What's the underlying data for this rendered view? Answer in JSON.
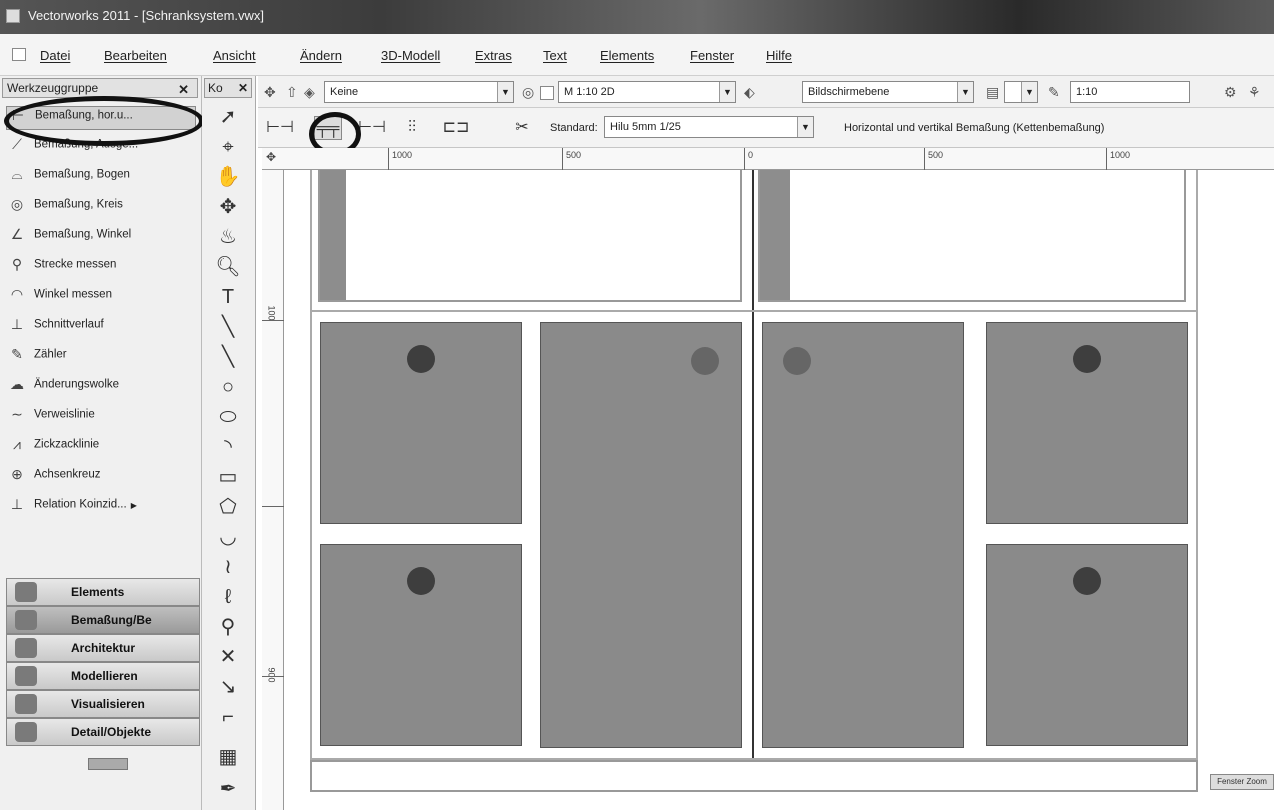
{
  "window": {
    "title": "Vectorworks 2011 - [Schranksystem.vwx]"
  },
  "menu": [
    "Datei",
    "Bearbeiten",
    "Ansicht",
    "Ändern",
    "3D-Modell",
    "Extras",
    "Text",
    "Elements",
    "Fenster",
    "Hilfe"
  ],
  "tools_panel": {
    "title": "Werkzeuggruppe",
    "items": [
      {
        "icon": "horizontal-dimension-icon",
        "label": "Bemaßung, hor.u..."
      },
      {
        "icon": "aligned-dimension-icon",
        "label": "Bemaßung, Ausge..."
      },
      {
        "icon": "arc-dimension-icon",
        "label": "Bemaßung, Bogen"
      },
      {
        "icon": "circle-dimension-icon",
        "label": "Bemaßung, Kreis"
      },
      {
        "icon": "angle-dimension-icon",
        "label": "Bemaßung, Winkel"
      },
      {
        "icon": "measure-distance-icon",
        "label": "Strecke messen"
      },
      {
        "icon": "measure-angle-icon",
        "label": "Winkel messen"
      },
      {
        "icon": "section-line-icon",
        "label": "Schnittverlauf"
      },
      {
        "icon": "counter-icon",
        "label": "Zähler"
      },
      {
        "icon": "revision-cloud-icon",
        "label": "Änderungswolke"
      },
      {
        "icon": "leader-line-icon",
        "label": "Verweislinie"
      },
      {
        "icon": "zigzag-line-icon",
        "label": "Zickzacklinie"
      },
      {
        "icon": "crosshair-icon",
        "label": "Achsenkreuz"
      },
      {
        "icon": "coincident-relation-icon",
        "label": "Relation Koinzid..."
      }
    ]
  },
  "palettes": [
    {
      "label": "Elements",
      "selected": false
    },
    {
      "label": "Bemaßung/Be",
      "selected": true
    },
    {
      "label": "Architektur",
      "selected": false
    },
    {
      "label": "Modellieren",
      "selected": false
    },
    {
      "label": "Visualisieren",
      "selected": false
    },
    {
      "label": "Detail/Objekte",
      "selected": false
    }
  ],
  "constraints_panel": {
    "title": "Ko"
  },
  "view_bar": {
    "class": "Keine",
    "layer": "M 1:10 2D",
    "view": "Bildschirmebene",
    "scale": "1:10"
  },
  "mode_bar": {
    "standard_label": "Standard:",
    "standard_value": "Hilu 5mm 1/25",
    "description": "Horizontal und vertikal Bemaßung (Kettenbemaßung)"
  },
  "ruler_top": [
    "1000",
    "500",
    "0",
    "500",
    "1000"
  ],
  "ruler_left": [
    "100",
    "900"
  ],
  "corner_button": "Fenster Zoom"
}
